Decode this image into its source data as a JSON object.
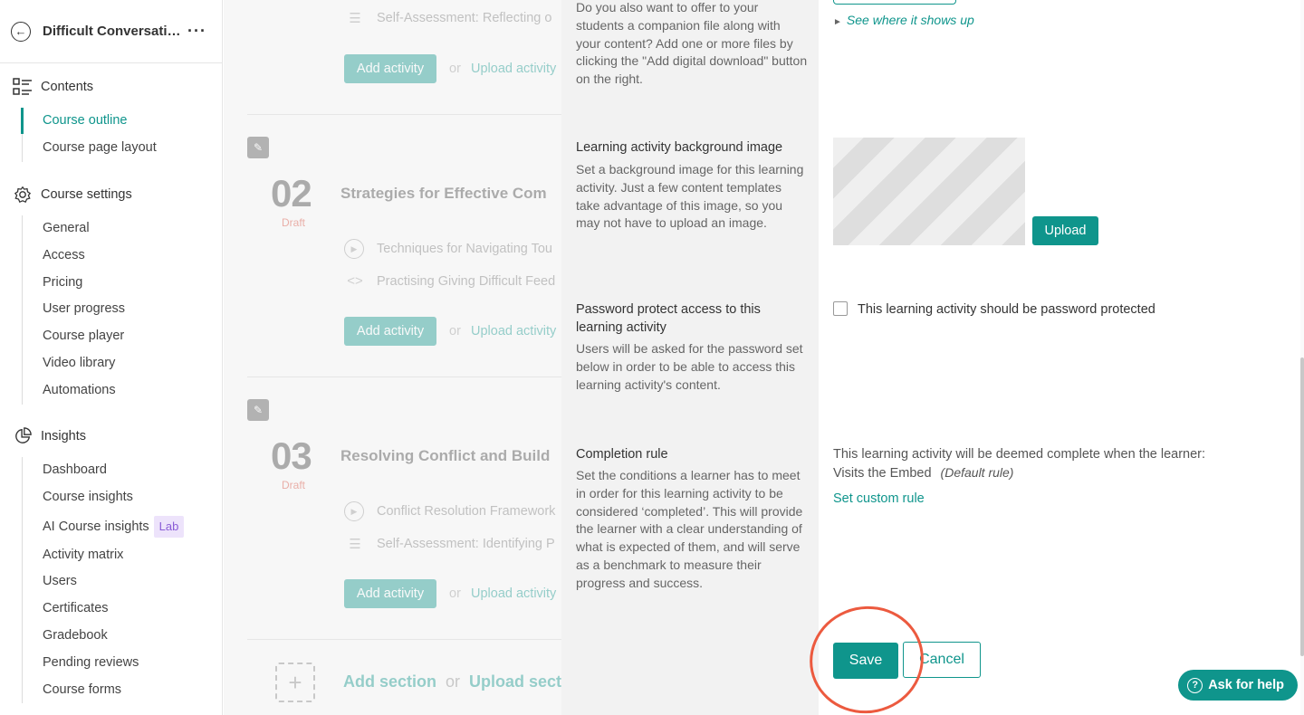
{
  "sidebar": {
    "course_title": "Difficult Conversati…",
    "more": "···",
    "contents": {
      "heading": "Contents",
      "items": [
        "Course outline",
        "Course page layout"
      ]
    },
    "settings": {
      "heading": "Course settings",
      "items": [
        "General",
        "Access",
        "Pricing",
        "User progress",
        "Course player",
        "Video library",
        "Automations"
      ]
    },
    "insights": {
      "heading": "Insights",
      "items": [
        "Dashboard",
        "Course insights",
        "AI Course insights",
        "Activity matrix",
        "Users",
        "Certificates",
        "Gradebook",
        "Pending reviews",
        "Course forms"
      ],
      "lab_badge": "Lab"
    }
  },
  "outline": {
    "top_activity": "Self-Assessment: Reflecting o",
    "sections": [
      {
        "number": "02",
        "status": "Draft",
        "title": "Strategies for Effective Com",
        "activities": [
          "Techniques for Navigating Tou",
          "Practising Giving Difficult Feed"
        ]
      },
      {
        "number": "03",
        "status": "Draft",
        "title": "Resolving Conflict and Build",
        "activities": [
          "Conflict Resolution Framework",
          "Self-Assessment: Identifying P"
        ]
      }
    ],
    "add_activity": "Add activity",
    "or": "or",
    "upload_activity": "Upload activity",
    "add_section": "Add section",
    "upload_section": "Upload sect"
  },
  "panel": {
    "download_desc": "Do you also want to offer to your students a companion file along with your content? Add one or more files by clicking the \"Add digital download\" button on the right.",
    "see_link": "See where it shows up",
    "bg_image": {
      "title": "Learning activity background image",
      "desc": "Set a background image for this learning activity. Just a few content templates take advantage of this image, so you may not have to upload an image.",
      "upload": "Upload"
    },
    "password": {
      "title": "Password protect access to this learning activity",
      "desc": "Users will be asked for the password set below in order to be able to access this learning activity's content.",
      "checkbox_label": "This learning activity should be password protected"
    },
    "completion": {
      "title": "Completion rule",
      "desc": "Set the conditions a learner has to meet in order for this learning activity to be considered ‘completed’. This will provide the learner with a clear understanding of what is expected of them, and will serve as a benchmark to measure their progress and success.",
      "line1": "This learning activity will be deemed complete when the learner:",
      "rule": "Visits the Embed",
      "default": "(Default rule)",
      "custom_link": "Set custom rule"
    },
    "save": "Save",
    "cancel": "Cancel"
  },
  "help": "Ask for help",
  "colors": {
    "accent": "#0f958c",
    "annotation": "#ec5a3f"
  }
}
